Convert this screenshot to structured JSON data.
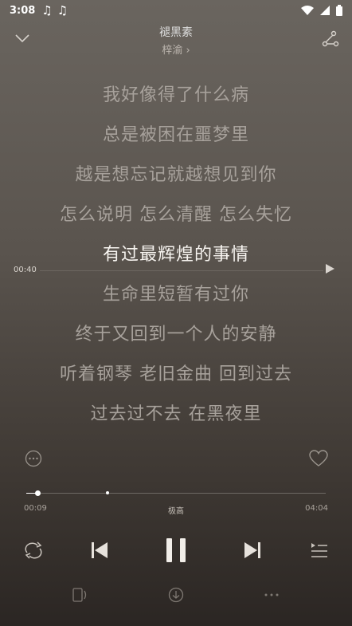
{
  "status_bar": {
    "time": "3:08",
    "note1": "♫",
    "note2": "♫"
  },
  "header": {
    "title": "褪黑素",
    "artist": "梓渝 ›"
  },
  "lyrics": [
    {
      "text": "我好像得了什么病"
    },
    {
      "text": "总是被困在噩梦里"
    },
    {
      "text": "越是想忘记就越想见到你"
    },
    {
      "text": "怎么说明 怎么清醒 怎么失忆"
    },
    {
      "text": "有过最辉煌的事情"
    },
    {
      "text": "生命里短暂有过你"
    },
    {
      "text": "终于又回到一个人的安静"
    },
    {
      "text": "听着钢琴 老旧金曲 回到过去"
    },
    {
      "text": "过去过不去 在黑夜里"
    }
  ],
  "seek": {
    "time": "00:40"
  },
  "playback": {
    "current": "00:09",
    "quality": "极高",
    "duration": "04:04",
    "progress_fraction": 0.037,
    "buffer_fraction": 0.27
  },
  "icons": {
    "collapse": "chevron-down-icon",
    "share": "share-icon",
    "more_circle": "more-circle-icon",
    "like": "heart-icon",
    "repeat": "repeat-icon",
    "prev": "previous-icon",
    "pause": "pause-icon",
    "next": "next-icon",
    "playlist": "playlist-icon",
    "device": "device-icon",
    "download": "download-icon",
    "more": "more-icon"
  }
}
